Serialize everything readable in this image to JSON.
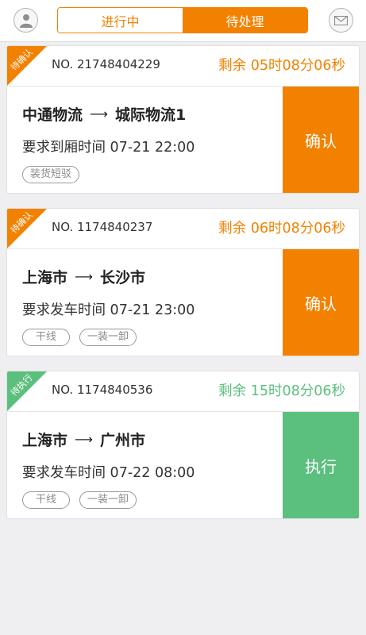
{
  "header": {
    "tabs": [
      {
        "label": "进行中",
        "active": false
      },
      {
        "label": "待处理",
        "active": true
      }
    ],
    "left_icon": "user-icon",
    "right_icon": "mail-icon"
  },
  "colors": {
    "orange": "#f38100",
    "green": "#5bbf7e"
  },
  "orders": [
    {
      "status": "待确认",
      "order_no": "NO. 21748404229",
      "remaining": "剩余 05时08分06秒",
      "from": "中通物流",
      "to": "城际物流1",
      "time_text": "要求到厢时间 07-21 22:00",
      "tags": [
        "装货短驳"
      ],
      "action": "确认"
    },
    {
      "status": "待确认",
      "order_no": "NO. 1174840237",
      "remaining": "剩余 06时08分06秒",
      "from": "上海市",
      "to": "长沙市",
      "time_text": "要求发车时间 07-21 23:00",
      "tags": [
        "干线",
        "一装一卸"
      ],
      "action": "确认"
    },
    {
      "status": "待执行",
      "order_no": "NO. 1174840536",
      "remaining": "剩余 15时08分06秒",
      "from": "上海市",
      "to": "广州市",
      "time_text": "要求发车时间 07-22 08:00",
      "tags": [
        "干线",
        "一装一卸"
      ],
      "action": "执行"
    }
  ]
}
